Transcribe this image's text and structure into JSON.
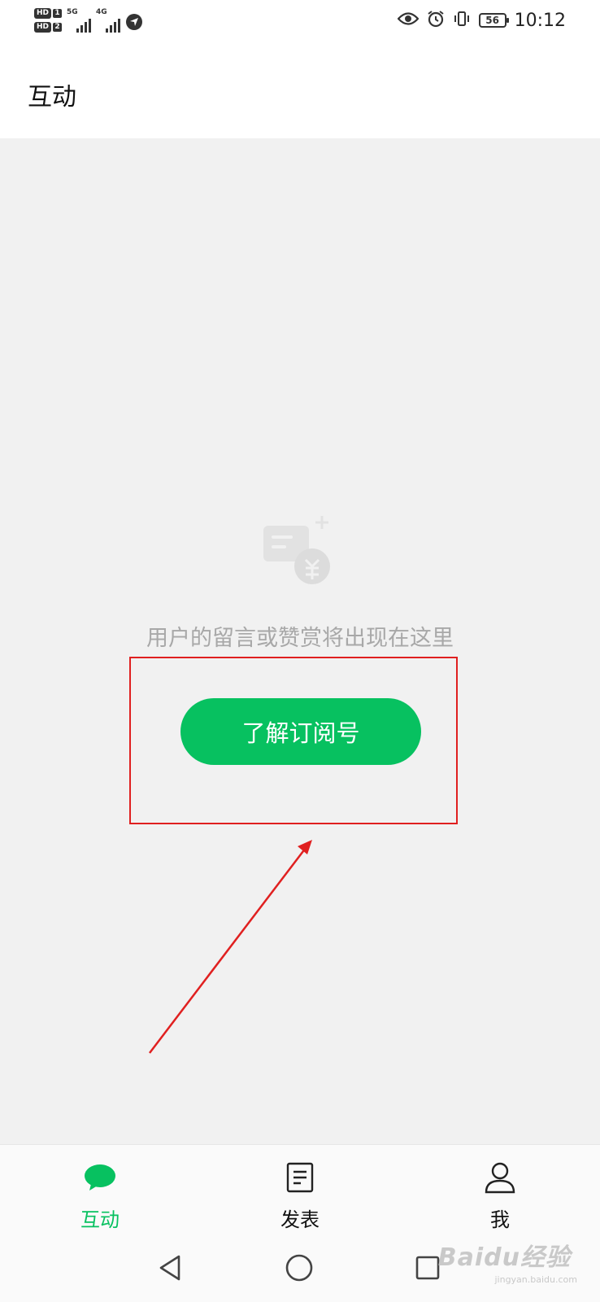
{
  "status_bar": {
    "sim1_badge": "HD",
    "sim1_num": "1",
    "sim2_badge": "HD",
    "sim2_num": "2",
    "net1": "5G",
    "net2": "4G",
    "battery": "56",
    "time": "10:12",
    "icons": [
      "eye-icon",
      "alarm-icon",
      "vibrate-icon",
      "battery-icon"
    ]
  },
  "header": {
    "title": "互动"
  },
  "main": {
    "empty_icon": "comment-reward-icon",
    "empty_text": "用户的留言或赞赏将出现在这里",
    "cta_label": "了解订阅号"
  },
  "tabs": [
    {
      "label": "互动",
      "icon": "chat-bubble-icon",
      "active": true
    },
    {
      "label": "发表",
      "icon": "document-icon",
      "active": false
    },
    {
      "label": "我",
      "icon": "person-icon",
      "active": false
    }
  ],
  "nav": [
    "back-icon",
    "home-icon",
    "recents-icon"
  ],
  "watermark": {
    "brand": "Baidu经验",
    "url": "jingyan.baidu.com"
  },
  "colors": {
    "accent": "#07c160",
    "annotation": "#e02020",
    "background": "#f1f1f1"
  }
}
